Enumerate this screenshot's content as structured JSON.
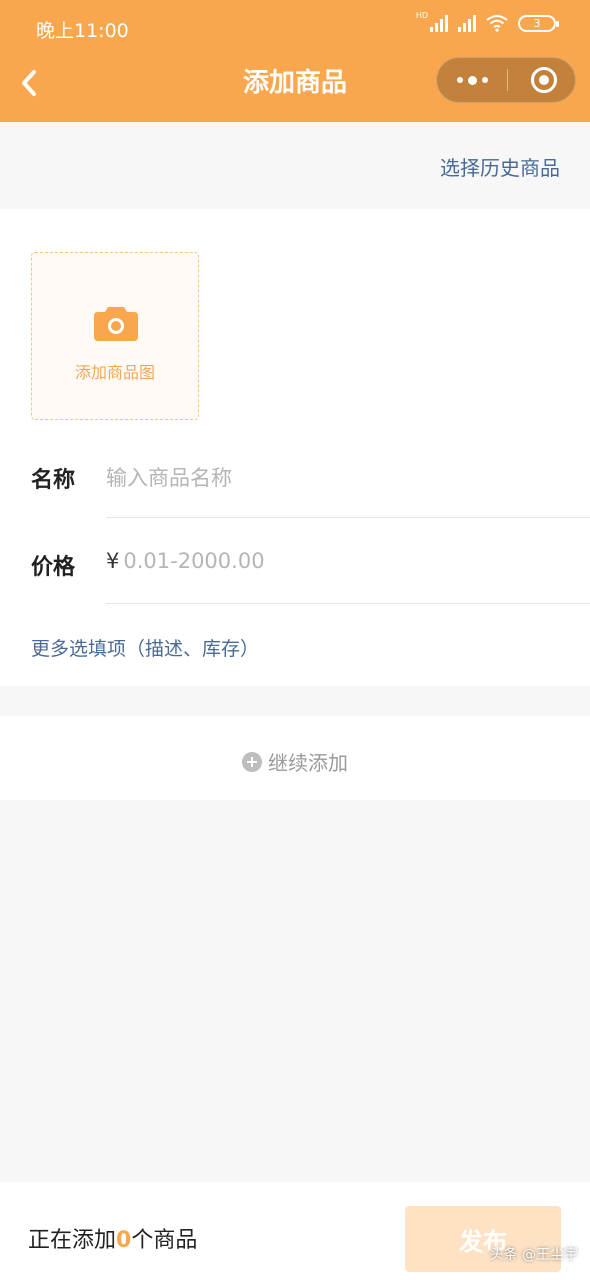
{
  "status_bar": {
    "time": "晚上11:00",
    "hd": "HD",
    "battery": "3"
  },
  "nav": {
    "title": "添加商品"
  },
  "history_link": "选择历史商品",
  "upload": {
    "label": "添加商品图"
  },
  "form": {
    "name_label": "名称",
    "name_placeholder": "输入商品名称",
    "price_label": "价格",
    "price_currency": "¥",
    "price_placeholder": "0.01-2000.00"
  },
  "more_options": "更多选填项（描述、库存）",
  "continue_add": "继续添加",
  "bottom": {
    "prefix": "正在添加",
    "count": "0",
    "suffix": "个商品",
    "publish": "发布"
  },
  "watermark": "头条 @王尘宇",
  "colors": {
    "accent": "#f9a74e",
    "link": "#4a6a96"
  }
}
